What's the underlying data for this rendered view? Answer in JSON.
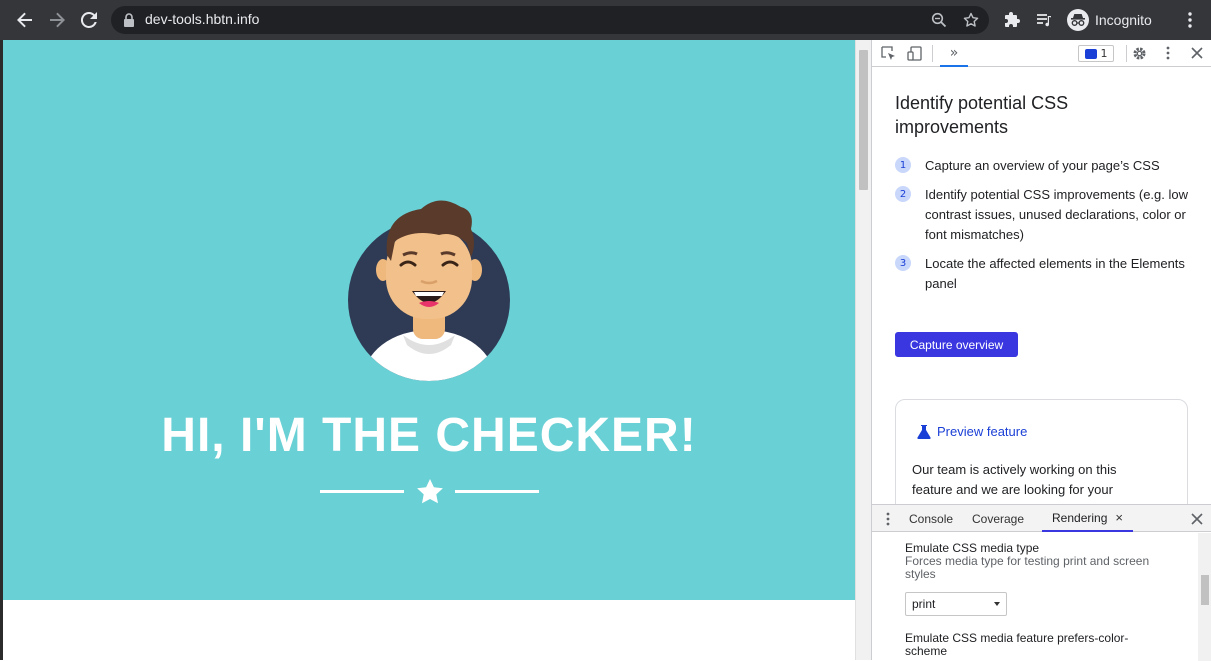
{
  "browser": {
    "url": "dev-tools.hbtn.info",
    "profile_label": "Incognito"
  },
  "page": {
    "hero_title": "HI, I'M THE CHECKER!",
    "hero_color": "#69d0d5"
  },
  "devtools": {
    "messages_count": "1",
    "more_tabs_label": "»",
    "css_overview": {
      "title": "Identify potential CSS improvements",
      "steps": [
        {
          "number": "1",
          "text": "Capture an overview of your page’s CSS"
        },
        {
          "number": "2",
          "text": "Identify potential CSS improvements (e.g. low contrast issues, unused declarations, color or font mismatches)"
        },
        {
          "number": "3",
          "text": "Locate the affected elements in the Elements panel"
        }
      ],
      "capture_button": "Capture overview",
      "preview_link": "Preview feature",
      "preview_text": "Our team is actively working on this feature and we are looking for your"
    },
    "drawer": {
      "tabs": [
        "Console",
        "Coverage",
        "Rendering"
      ],
      "active_tab": "Rendering",
      "settings": [
        {
          "title": "Emulate CSS media type",
          "description": "Forces media type for testing print and screen styles",
          "value": "print"
        },
        {
          "title": "Emulate CSS media feature prefers-color-scheme"
        }
      ]
    }
  }
}
